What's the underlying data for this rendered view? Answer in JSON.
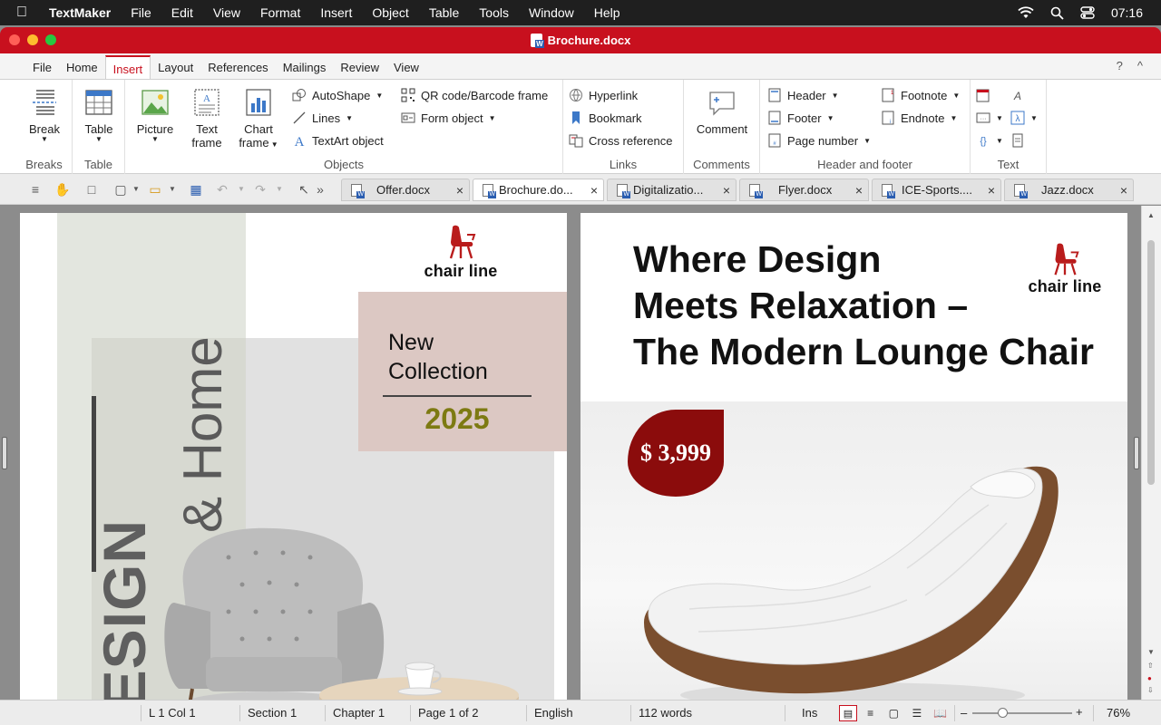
{
  "menubar": {
    "app_name": "TextMaker",
    "items": [
      "File",
      "Edit",
      "View",
      "Format",
      "Insert",
      "Object",
      "Table",
      "Tools",
      "Window",
      "Help"
    ],
    "clock": "07:16"
  },
  "window": {
    "title": "Brochure.docx"
  },
  "ribbon_tabs": [
    "File",
    "Home",
    "Insert",
    "Layout",
    "References",
    "Mailings",
    "Review",
    "View"
  ],
  "ribbon_tabs_right": [
    "?",
    "^"
  ],
  "ribbon": {
    "breaks": {
      "label": "Breaks",
      "break_button": "Break"
    },
    "table": {
      "label": "Table",
      "table_button": "Table"
    },
    "objects": {
      "label": "Objects",
      "picture": "Picture",
      "text_frame_1": "Text",
      "text_frame_2": "frame",
      "chart_frame_1": "Chart",
      "chart_frame_2": "frame",
      "autoshape": "AutoShape",
      "lines": "Lines",
      "textart": "TextArt object",
      "qr": "QR code/Barcode frame",
      "form": "Form object"
    },
    "links": {
      "label": "Links",
      "hyperlink": "Hyperlink",
      "bookmark": "Bookmark",
      "cross_ref": "Cross reference"
    },
    "comments": {
      "label": "Comments",
      "comment": "Comment"
    },
    "header_footer": {
      "label": "Header and footer",
      "header": "Header",
      "footer": "Footer",
      "page_number": "Page number",
      "footnote": "Footnote",
      "endnote": "Endnote"
    },
    "text": {
      "label": "Text"
    }
  },
  "doc_tabs": [
    "Offer.docx",
    "Brochure.do...",
    "Digitalizatio...",
    "Flyer.docx",
    "ICE-Sports....",
    "Jazz.docx"
  ],
  "document": {
    "left_page": {
      "brand": "chair line",
      "vertical_text_1": "DESIGN",
      "vertical_text_2": "& Home",
      "collection_line1": "New",
      "collection_line2": "Collection",
      "year": "2025"
    },
    "right_page": {
      "headline_1": "Where Design",
      "headline_2": "Meets Relaxation –",
      "headline_3": "The Modern Lounge Chair",
      "brand": "chair line",
      "price": "$ 3,999"
    }
  },
  "statusbar": {
    "position": "L 1 Col 1",
    "section": "Section 1",
    "chapter": "Chapter 1",
    "page": "Page 1 of 2",
    "language": "English",
    "words": "112 words",
    "mode": "Ins",
    "zoom": "76%"
  },
  "colors": {
    "brand_red": "#c8101e",
    "price_badge": "#8b0c0c",
    "year_olive": "#7d7a12",
    "collection_box": "#dcc8c3",
    "left_band": "#e3e6df"
  }
}
